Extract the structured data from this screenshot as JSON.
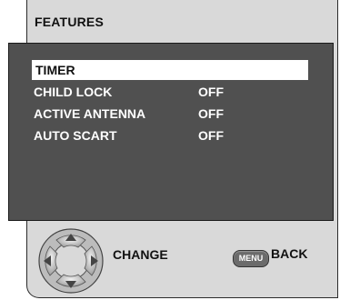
{
  "screen": {
    "title": "FEATURES"
  },
  "menu": {
    "items": [
      {
        "label": "TIMER",
        "value": ""
      },
      {
        "label": "CHILD LOCK",
        "value": "OFF"
      },
      {
        "label": "ACTIVE ANTENNA",
        "value": "OFF"
      },
      {
        "label": "AUTO SCART",
        "value": "OFF"
      }
    ],
    "selected_index": 0
  },
  "hints": {
    "navigate_label": "CHANGE",
    "menu_key_label": "MENU",
    "back_label": "BACK"
  },
  "icons": {
    "dpad": "dpad-icon",
    "menu_key": "menu-key-icon"
  },
  "colors": {
    "frame_bg": "#d9d9d9",
    "panel_bg": "#505050",
    "selected_bg": "#ffffff",
    "text_light": "#ffffff",
    "text_dark": "#111111"
  }
}
